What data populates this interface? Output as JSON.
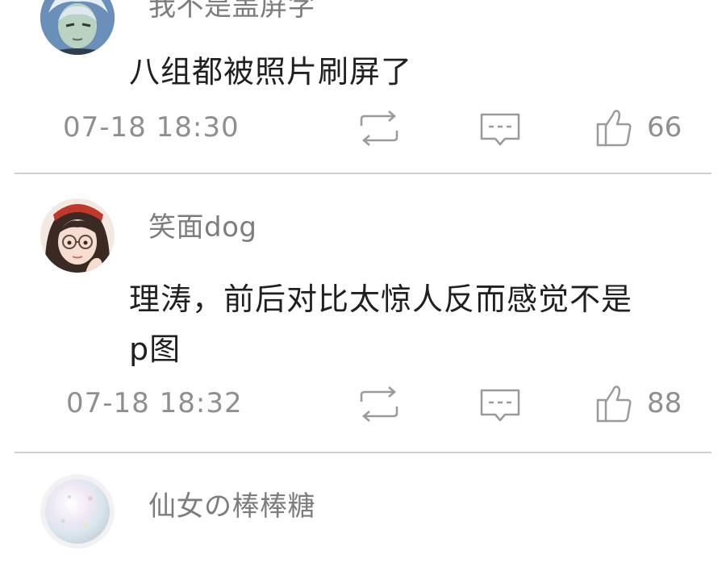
{
  "comments": [
    {
      "username": "我不是盖屏字",
      "content": "八组都被照片刷屏了",
      "timestamp": "07-18  18:30",
      "likes": "66",
      "avatar": "anime-white-haired-avatar"
    },
    {
      "username": "笑面dog",
      "content": "理涛，前后对比太惊人反而感觉不是p图",
      "timestamp": "07-18  18:32",
      "likes": "88",
      "avatar": "anime-girl-glasses-avatar"
    },
    {
      "username": "仙女の棒棒糖",
      "content": "",
      "avatar": "pastel-orb-avatar"
    }
  ],
  "icons": {
    "repost": "repost-icon",
    "reply": "reply-icon",
    "like": "thumbs-up-icon"
  },
  "colors": {
    "text_primary": "#202020",
    "text_secondary": "#8f8f8f",
    "divider": "#cfcfcf",
    "background": "#ffffff"
  }
}
